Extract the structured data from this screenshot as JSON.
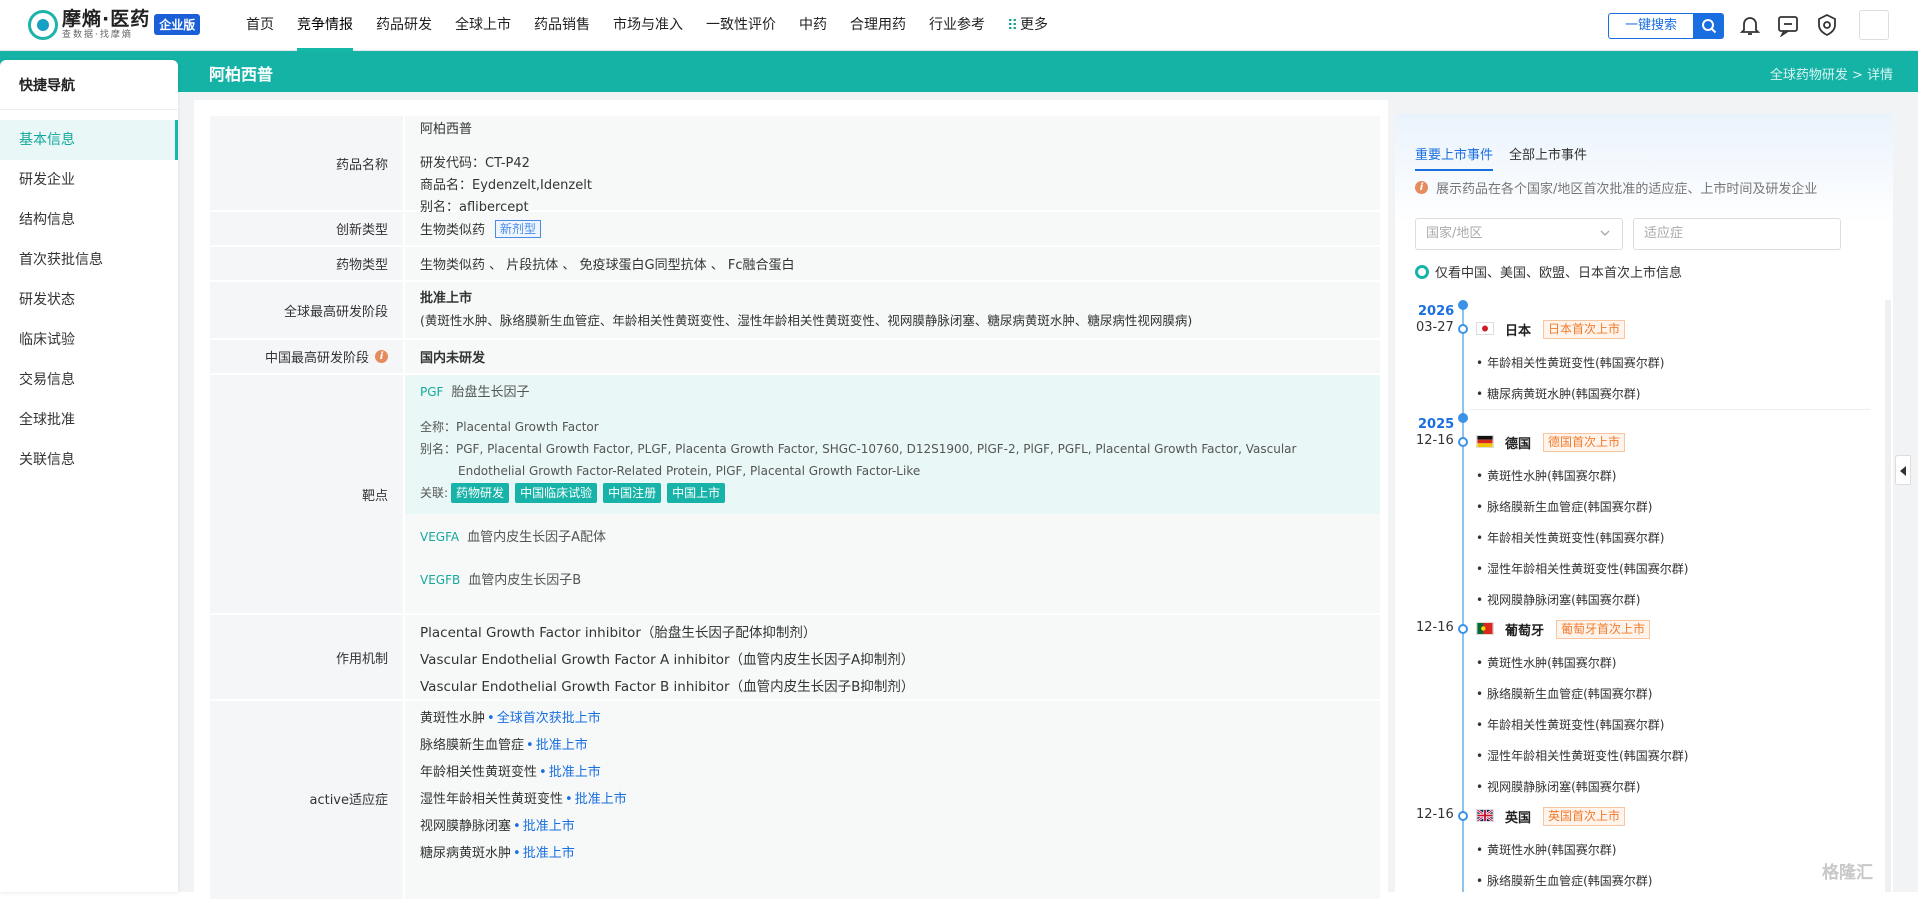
{
  "header": {
    "logo_main": "摩熵·医药",
    "logo_sub": "查数据·找摩熵",
    "logo_badge": "企业版",
    "nav": [
      "首页",
      "竞争情报",
      "药品研发",
      "全球上市",
      "药品销售",
      "市场与准入",
      "一致性评价",
      "中药",
      "合理用药",
      "行业参考",
      "更多"
    ],
    "active_nav": "竞争情报",
    "search_label": "一键搜索",
    "icons": [
      "search-icon",
      "bell-icon",
      "feedback-icon",
      "shield-icon"
    ]
  },
  "page": {
    "title": "阿柏西普",
    "breadcrumb": "全球药物研发 > 详情"
  },
  "sidebar": {
    "heading": "快捷导航",
    "items": [
      "基本信息",
      "研发企业",
      "结构信息",
      "首次获批信息",
      "研发状态",
      "临床试验",
      "交易信息",
      "全球批准",
      "关联信息"
    ],
    "active": "基本信息"
  },
  "info": {
    "drug_name": {
      "label": "药品名称",
      "name": "阿柏西普",
      "code": "研发代码：CT-P42",
      "trade": "商品名：Eydenzelt,Idenzelt",
      "alias": "别名：aflibercept"
    },
    "innovation": {
      "label": "创新类型",
      "value": "生物类似药",
      "tag": "新剂型"
    },
    "drug_type": {
      "label": "药物类型",
      "value": "生物类似药 、 片段抗体 、 免疫球蛋白G同型抗体 、 Fc融合蛋白"
    },
    "global_stage": {
      "label": "全球最高研发阶段",
      "value": "批准上市",
      "detail": "(黄斑性水肿、脉络膜新生血管症、年龄相关性黄斑变性、湿性年龄相关性黄斑变性、视网膜静脉闭塞、糖尿病黄斑水肿、糖尿病性视网膜病)"
    },
    "china_stage": {
      "label": "中国最高研发阶段",
      "value": "国内未研发"
    },
    "targets": {
      "label": "靶点",
      "items": [
        {
          "code": "PGF",
          "name": "胎盘生长因子",
          "fullname": "全称：Placental Growth Factor",
          "alias": "别名：PGF, Placental Growth Factor, PLGF, Placenta Growth Factor, SHGC-10760, D12S1900, PlGF-2, PlGF, PGFL, Placental Growth Factor, Vascular Endothelial Growth Factor-Related Protein, PlGF, Placental Growth Factor-Like",
          "related_label": "关联:",
          "chips": [
            "药物研发",
            "中国临床试验",
            "中国注册",
            "中国上市"
          ]
        },
        {
          "code": "VEGFA",
          "name": "血管内皮生长因子A配体"
        },
        {
          "code": "VEGFB",
          "name": "血管内皮生长因子B"
        }
      ]
    },
    "mechanism": {
      "label": "作用机制",
      "items": [
        "Placental Growth Factor inhibitor（胎盘生长因子配体抑制剂）",
        "Vascular Endothelial Growth Factor A inhibitor（血管内皮生长因子A抑制剂）",
        "Vascular Endothelial Growth Factor B inhibitor（血管内皮生长因子B抑制剂）"
      ]
    },
    "indications": {
      "label": "active适应症",
      "items": [
        {
          "name": "黄斑性水肿",
          "status": "全球首次获批上市"
        },
        {
          "name": "脉络膜新生血管症",
          "status": "批准上市"
        },
        {
          "name": "年龄相关性黄斑变性",
          "status": "批准上市"
        },
        {
          "name": "湿性年龄相关性黄斑变性",
          "status": "批准上市"
        },
        {
          "name": "视网膜静脉闭塞",
          "status": "批准上市"
        },
        {
          "name": "糖尿病黄斑水肿",
          "status": "批准上市"
        }
      ]
    }
  },
  "events": {
    "tabs": [
      "重要上市事件",
      "全部上市事件"
    ],
    "active_tab": "重要上市事件",
    "note": "展示药品在各个国家/地区首次批准的适应症、上市时间及研发企业",
    "country_placeholder": "国家/地区",
    "indication_placeholder": "适应症",
    "radio_label": "仅看中国、美国、欧盟、日本首次上市信息",
    "timeline": [
      {
        "year": "2026",
        "date": "03-27",
        "country": "日本",
        "tag": "日本首次上市",
        "flag": "jp",
        "events": [
          "年龄相关性黄斑变性(韩国赛尔群)",
          "糖尿病黄斑水肿(韩国赛尔群)"
        ]
      },
      {
        "year": "2025",
        "date": "12-16",
        "country": "德国",
        "tag": "德国首次上市",
        "flag": "de",
        "events": [
          "黄斑性水肿(韩国赛尔群)",
          "脉络膜新生血管症(韩国赛尔群)",
          "年龄相关性黄斑变性(韩国赛尔群)",
          "湿性年龄相关性黄斑变性(韩国赛尔群)",
          "视网膜静脉闭塞(韩国赛尔群)"
        ]
      },
      {
        "date": "12-16",
        "country": "葡萄牙",
        "tag": "葡萄牙首次上市",
        "flag": "pt",
        "events": [
          "黄斑性水肿(韩国赛尔群)",
          "脉络膜新生血管症(韩国赛尔群)",
          "年龄相关性黄斑变性(韩国赛尔群)",
          "湿性年龄相关性黄斑变性(韩国赛尔群)",
          "视网膜静脉闭塞(韩国赛尔群)"
        ]
      },
      {
        "date": "12-16",
        "country": "英国",
        "tag": "英国首次上市",
        "flag": "gb",
        "events": [
          "黄斑性水肿(韩国赛尔群)",
          "脉络膜新生血管症(韩国赛尔群)"
        ]
      }
    ]
  },
  "watermark": "格隆汇",
  "colors": {
    "teal": "#15b2a6",
    "blue": "#1a6fe0",
    "orange": "#f07b2c"
  }
}
